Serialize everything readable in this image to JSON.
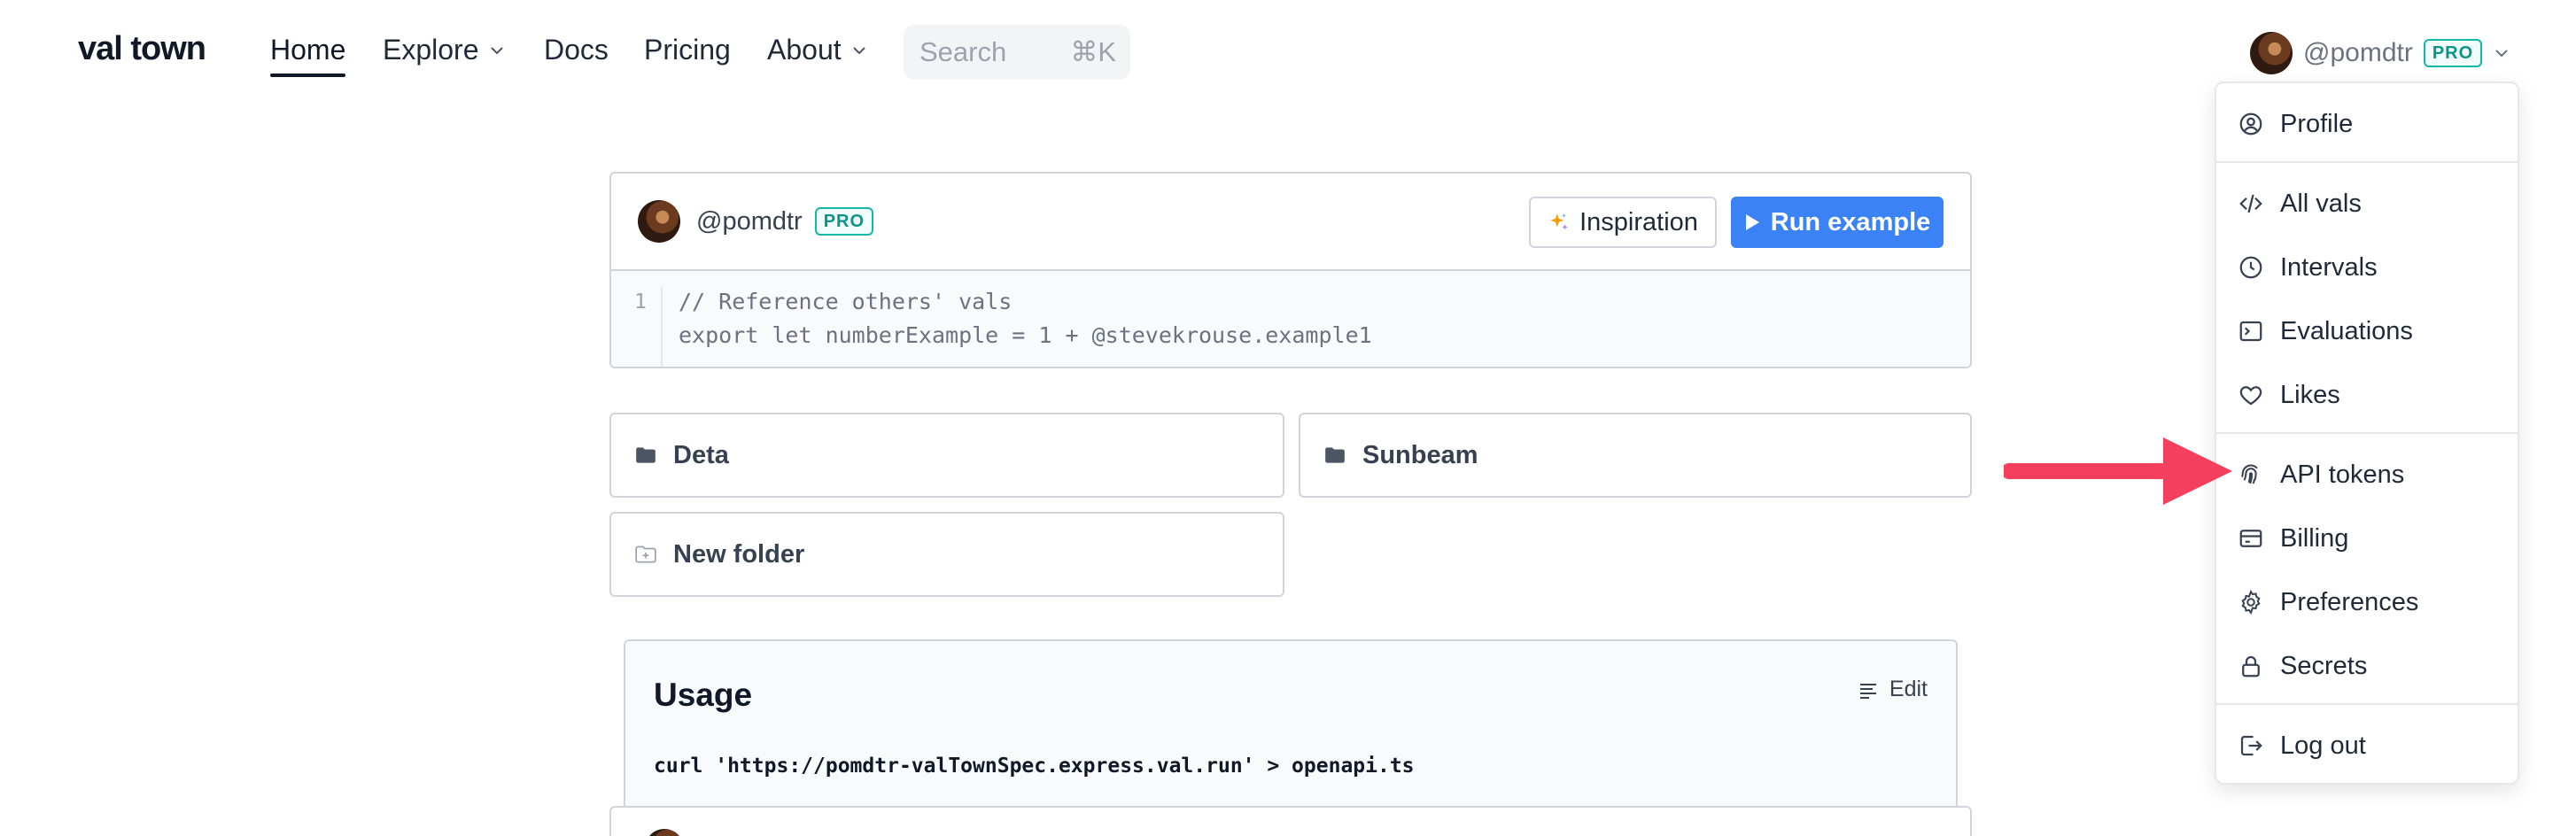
{
  "nav": {
    "logo": "val town",
    "links": [
      {
        "label": "Home",
        "active": true
      },
      {
        "label": "Explore",
        "dropdown": true
      },
      {
        "label": "Docs"
      },
      {
        "label": "Pricing"
      },
      {
        "label": "About",
        "dropdown": true
      }
    ],
    "search": {
      "placeholder": "Search",
      "shortcut": "⌘K"
    },
    "user": {
      "handle": "@pomdtr",
      "badge": "PRO"
    }
  },
  "user_menu": {
    "items": [
      {
        "label": "Profile",
        "icon": "user-circle-icon"
      },
      {
        "label": "All vals",
        "icon": "code-icon"
      },
      {
        "label": "Intervals",
        "icon": "clock-icon"
      },
      {
        "label": "Evaluations",
        "icon": "terminal-icon"
      },
      {
        "label": "Likes",
        "icon": "heart-icon"
      },
      {
        "label": "API tokens",
        "icon": "fingerprint-icon"
      },
      {
        "label": "Billing",
        "icon": "credit-card-icon"
      },
      {
        "label": "Preferences",
        "icon": "gear-icon"
      },
      {
        "label": "Secrets",
        "icon": "lock-icon"
      },
      {
        "label": "Log out",
        "icon": "logout-icon"
      }
    ]
  },
  "annotation": {
    "color": "#f43f5e"
  },
  "editor_card": {
    "handle": "@pomdtr",
    "badge": "PRO",
    "inspiration_label": "Inspiration",
    "run_label": "Run example",
    "line_number": "1",
    "code_lines": [
      "// Reference others' vals",
      "export let numberExample = 1 + @stevekrouse.example1"
    ]
  },
  "folders": [
    {
      "label": "Deta",
      "icon": "folder-icon"
    },
    {
      "label": "Sunbeam",
      "icon": "folder-icon"
    },
    {
      "label": "New folder",
      "icon": "folder-plus-icon"
    }
  ],
  "usage": {
    "title": "Usage",
    "edit_label": "Edit",
    "command": "curl 'https://pomdtr-valTownSpec.express.val.run' > openapi.ts"
  },
  "colors": {
    "accent": "#3b82f6",
    "pro": "#14b8a6"
  }
}
